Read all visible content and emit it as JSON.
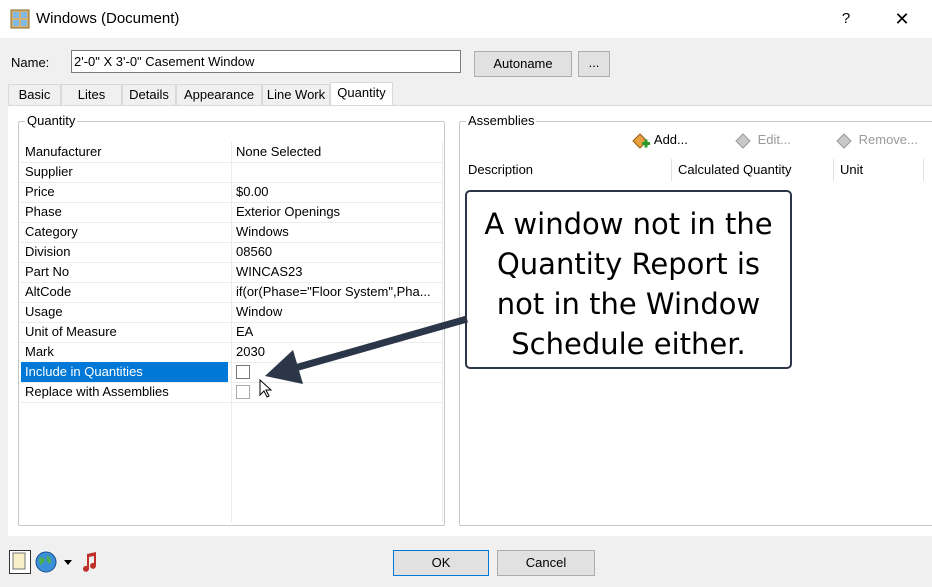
{
  "window": {
    "title": "Windows (Document)",
    "help_label": "?",
    "close_label": "✕"
  },
  "name_row": {
    "label": "Name:",
    "value": "2'-0\" X 3'-0\" Casement Window",
    "autoname_label": "Autoname",
    "ellipsis_label": "..."
  },
  "tabs": [
    {
      "label": "Basic",
      "active": false
    },
    {
      "label": "Lites",
      "active": false
    },
    {
      "label": "Details",
      "active": false
    },
    {
      "label": "Appearance",
      "active": false
    },
    {
      "label": "Line Work",
      "active": false
    },
    {
      "label": "Quantity",
      "active": true
    }
  ],
  "quantity_group": {
    "title": "Quantity",
    "rows": [
      {
        "name": "Manufacturer",
        "value": "None Selected"
      },
      {
        "name": "Supplier",
        "value": ""
      },
      {
        "name": "Price",
        "value": "$0.00"
      },
      {
        "name": "Phase",
        "value": "Exterior Openings"
      },
      {
        "name": "Category",
        "value": "Windows"
      },
      {
        "name": "Division",
        "value": "08560"
      },
      {
        "name": "Part No",
        "value": "WINCAS23"
      },
      {
        "name": "AltCode",
        "value": "if(or(Phase=\"Floor System\",Pha..."
      },
      {
        "name": "Usage",
        "value": "Window"
      },
      {
        "name": "Unit of Measure",
        "value": "EA"
      },
      {
        "name": "Mark",
        "value": "2030"
      },
      {
        "name": "Include in Quantities",
        "value": "",
        "checked": false
      },
      {
        "name": "Replace with Assemblies",
        "value": "",
        "checked": false
      }
    ]
  },
  "assemblies_group": {
    "title": "Assemblies",
    "add_label": "Add...",
    "edit_label": "Edit...",
    "remove_label": "Remove...",
    "columns": [
      "Description",
      "Calculated Quantity",
      "Unit"
    ]
  },
  "callout": {
    "lines": [
      "A window not in the",
      "Quantity Report is",
      "not in the Window",
      "Schedule either."
    ]
  },
  "footer": {
    "ok_label": "OK",
    "cancel_label": "Cancel"
  },
  "colors": {
    "selection": "#0078d7",
    "callout_border": "#2b3648",
    "arrow": "#2b3648"
  }
}
